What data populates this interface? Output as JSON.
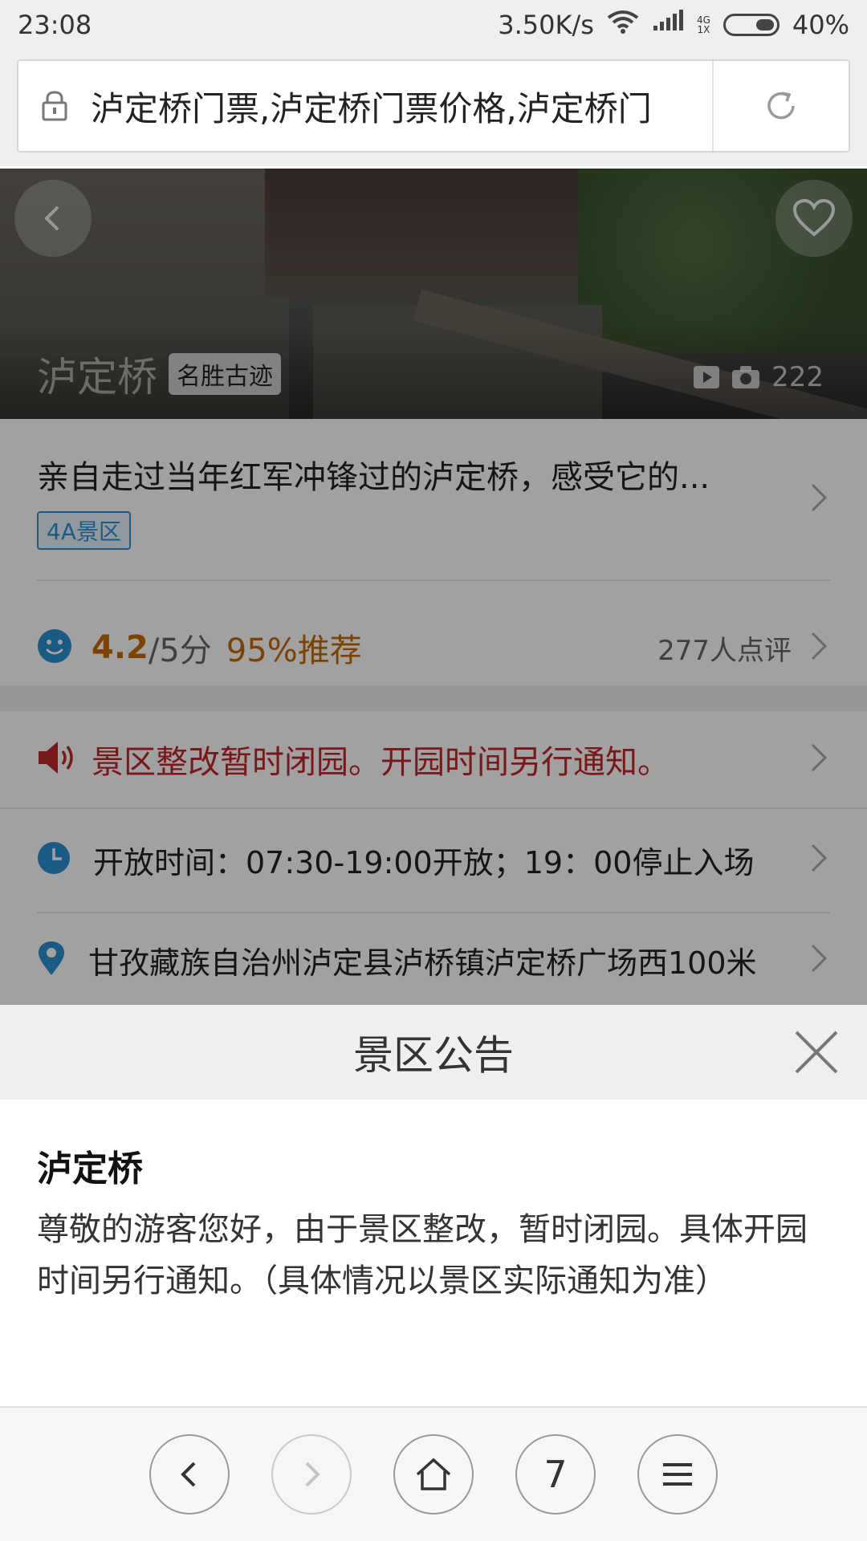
{
  "status_bar": {
    "time": "23:08",
    "net_speed": "3.50K/s",
    "net_type_top": "4G",
    "net_type_bottom": "1X",
    "battery_percent": "40%"
  },
  "url_bar": {
    "text": "泸定桥门票,泸定桥门票价格,泸定桥门"
  },
  "hero": {
    "name": "泸定桥",
    "tag": "名胜古迹",
    "photo_count": "222"
  },
  "info": {
    "description": "亲自走过当年红军冲锋过的泸定桥，感受它的...",
    "badge": "4A景区",
    "rating_score": "4.2",
    "rating_outof": "/5分",
    "recommend": "95%推荐",
    "reviews": "277人点评",
    "notice": "景区整改暂时闭园。开园时间另行通知。",
    "hours": "开放时间：07:30-19:00开放；19：00停止入场",
    "address": "甘孜藏族自治州泸定县泸桥镇泸定桥广场西100米"
  },
  "sheet": {
    "title": "景区公告",
    "subtitle": "泸定桥",
    "text": "尊敬的游客您好，由于景区整改，暂时闭园。具体开园时间另行通知。（具体情况以景区实际通知为准）"
  },
  "nav": {
    "tabs_count": "7"
  },
  "colors": {
    "accent_orange": "#c56a00",
    "notice_red": "#c0262b",
    "badge_blue": "#2a8fd0"
  }
}
